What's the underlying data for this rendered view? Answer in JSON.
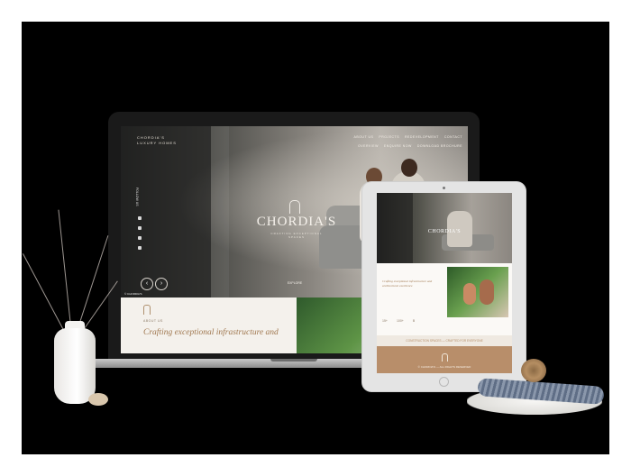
{
  "laptop": {
    "brand_lines": [
      "CHORDIA'S",
      "LUXURY HOMES"
    ],
    "nav_primary": [
      "ABOUT US",
      "PROJECTS",
      "REDEVELOPMENT",
      "CONTACT"
    ],
    "nav_secondary": [
      "OVERVIEW",
      "ENQUIRE NOW",
      "DOWNLOAD BROCHURE"
    ],
    "side_label": "FOLLOW US",
    "logo_text": "CHORDIA'S",
    "logo_sub": "CRAFTING EXCEPTIONAL SPACES",
    "cta_label": "EXPLORE",
    "prev_arrow": "‹",
    "next_arrow": "›",
    "hero_caption": "© CHORDIA'S",
    "about_label": "ABOUT US",
    "about_heading": "Crafting exceptional infrastructure and"
  },
  "tablet": {
    "logo_text": "CHORDIA'S",
    "about_text": "Crafting exceptional infrastructure and architectural excellence",
    "stats": [
      "15+",
      "100+",
      "B"
    ],
    "banner_text": "CONSTRUCTION SPACES — CRAFTED FOR EVERYONE",
    "footer_text": "© CHORDIA'S — ALL RIGHTS RESERVED"
  },
  "colors": {
    "accent": "#b88e6a",
    "heading": "#a07850",
    "background": "#000000"
  }
}
